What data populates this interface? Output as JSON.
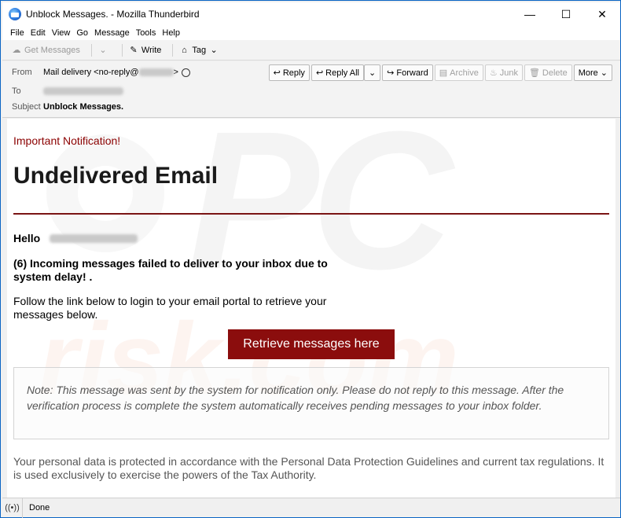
{
  "window": {
    "title": "Unblock Messages. - Mozilla Thunderbird",
    "minimize": "—",
    "maximize": "☐",
    "close": "✕"
  },
  "menu": [
    "File",
    "Edit",
    "View",
    "Go",
    "Message",
    "Tools",
    "Help"
  ],
  "toolbar": {
    "get_messages": "Get Messages",
    "write": "Write",
    "tag": "Tag"
  },
  "header": {
    "from_label": "From",
    "from_value_prefix": "Mail delivery <no-reply@",
    "from_value_suffix": ">",
    "to_label": "To",
    "subject_label": "Subject",
    "subject_value": "Unblock Messages.",
    "buttons": {
      "reply": "Reply",
      "reply_all": "Reply All",
      "forward": "Forward",
      "archive": "Archive",
      "junk": "Junk",
      "delete": "Delete",
      "more": "More"
    }
  },
  "body": {
    "important": "Important Notification!",
    "headline": "Undelivered Email",
    "hello": "Hello",
    "incoming": "(6) Incoming messages failed to deliver to your inbox due to system delay!  .",
    "follow": "Follow the link below to login to your email portal to retrieve your messages below.",
    "cta": "Retrieve messages here",
    "note": "Note: This message was sent by the system for notification only.  Please do not reply to this message. After the verification process is complete the system automatically receives pending messages to your inbox folder.",
    "footer": "Your personal data is protected in accordance with the Personal Data Protection Guidelines and current tax regulations. It is used exclusively to exercise the powers of the Tax Authority.",
    "accent_color": "#8b0d0d"
  },
  "status": {
    "text": "Done"
  }
}
